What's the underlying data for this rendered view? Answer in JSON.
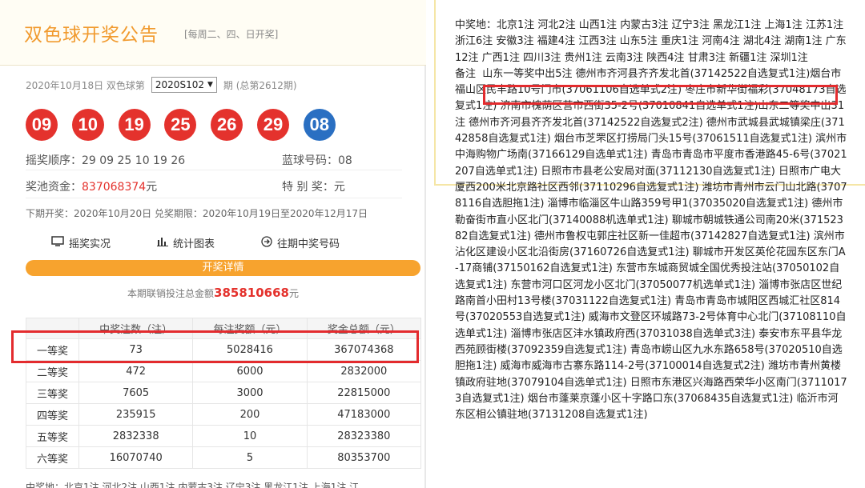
{
  "header": {
    "title": "双色球开奖公告",
    "schedule": "[每周二、四、日开奖]"
  },
  "draw": {
    "date_prefix": "2020年10月18日 双色球第",
    "issue": "2020S102",
    "issue_suffix": "期 (总第2612期)"
  },
  "balls": {
    "red": [
      "09",
      "10",
      "19",
      "25",
      "26",
      "29"
    ],
    "blue": "08"
  },
  "info": {
    "order_label": "摇奖顺序：",
    "order_value": "29 09 25 10 19 26",
    "blue_label": "蓝球号码：",
    "blue_value": "08",
    "pool_label": "奖池资金：",
    "pool_value": "837068374",
    "pool_unit": "元",
    "special_label": "特 别 奖：",
    "special_value": "元"
  },
  "next_draw": "下期开奖：2020年10月20日 兑奖期限：2020年10月19日至2020年12月17日",
  "links": [
    {
      "icon": "monitor-icon",
      "label": "摇奖实况"
    },
    {
      "icon": "bar-chart-icon",
      "label": "统计图表"
    },
    {
      "icon": "arrow-circle-icon",
      "label": "往期中奖号码"
    }
  ],
  "details_bar": "开奖详情",
  "sales": {
    "prefix": "本期联销投注总金额",
    "amount": "385810668",
    "unit": "元"
  },
  "prize_table": {
    "headers": [
      "",
      "中奖注数（注）",
      "每注奖额（元）",
      "奖金总额（元）"
    ],
    "rows": [
      [
        "一等奖",
        "73",
        "5028416",
        "367074368"
      ],
      [
        "二等奖",
        "472",
        "6000",
        "2832000"
      ],
      [
        "三等奖",
        "7605",
        "3000",
        "22815000"
      ],
      [
        "四等奖",
        "235915",
        "200",
        "47183000"
      ],
      [
        "五等奖",
        "2832338",
        "10",
        "28323380"
      ],
      [
        "六等奖",
        "16070740",
        "5",
        "80353700"
      ]
    ]
  },
  "cut_line": "中奖地：北京1注 河北2注 山西1注 内蒙古3注 辽宁3注 黑龙江1注 上海1注 江",
  "right": {
    "winners": "中奖地：北京1注 河北2注 山西1注 内蒙古3注 辽宁3注 黑龙江1注 上海1注 江苏1注 浙江6注 安徽3注 福建4注 江西3注 山东5注 重庆1注 河南4注 湖北4注 湖南1注 广东12注 广西1注 四川3注 贵州1注 云南3注 陕西4注 甘肃3注 新疆1注 深圳1注",
    "note_label": "备注",
    "note_highlight": "山东一等奖中出5注 德州市齐河县齐齐发北首(37142522自选复式1注)",
    "note_rest": "烟台市福山区民丰路10号门市(37061106自选单式2注) 枣庄市新华街福彩(37048173自选复式1注) 济南市槐荫区营市西街35-2号(37010841自选单式1注)山东二等奖中出31注 德州市齐河县齐齐发北首(37142522自选复式2注) 德州市武城县武城镇梁庄(37142858自选复式1注) 烟台市芝罘区打捞局门头15号(37061511自选复式1注) 滨州市中海购物广场南(37166129自选单式1注) 青岛市青岛市平度市香港路45-6号(37021207自选单式1注) 日照市市县老公安局对面(37112130自选复式1注) 日照市广电大厦西200米北京路社区西邻(37110296自选复式1注) 潍坊市青州市云门山北路(37078116自选胆拖1注) 淄博市临淄区牛山路359号甲1(37035020自选复式1注) 德州市勒奋街市直小区北门(37140088机选单式1注) 聊城市朝城铁通公司南20米(37152382自选复式1注) 德州市鲁权屯郭庄社区新一佳超市(37142827自选复式1注) 滨州市沾化区建设小区北沿街房(37160726自选复式1注) 聊城市开发区英伦花园东区东门A-17商铺(37150162自选复式1注) 东营市东城商贸城全国优秀投注站(37050102自选复式1注) 东营市河口区河龙小区北门(37050077机选单式1注) 淄博市张店区世纪路南首小田村13号楼(37031122自选复式1注) 青岛市青岛市城阳区西城汇社区814号(37020553自选复式1注) 威海市文登区环城路73-2号体育中心北门(37108110自选单式1注) 淄博市张店区沣水镇政府西(37031038自选单式3注) 泰安市东平县华龙西苑顾街楼(37092359自选复式1注) 青岛市崂山区九水东路658号(37020510自选胆拖1注) 威海市威海市古寨东路114-2号(37100014自选复式2注) 潍坊市青州黄楼镇政府驻地(37079104自选单式1注) 日照市东港区兴海路西荣华小区南门(37110173自选复式1注) 烟台市蓬莱京蓬小区十字路口东(37068435自选复式1注) 临沂市河东区相公镇驻地(37131208自选复式1注)"
  }
}
